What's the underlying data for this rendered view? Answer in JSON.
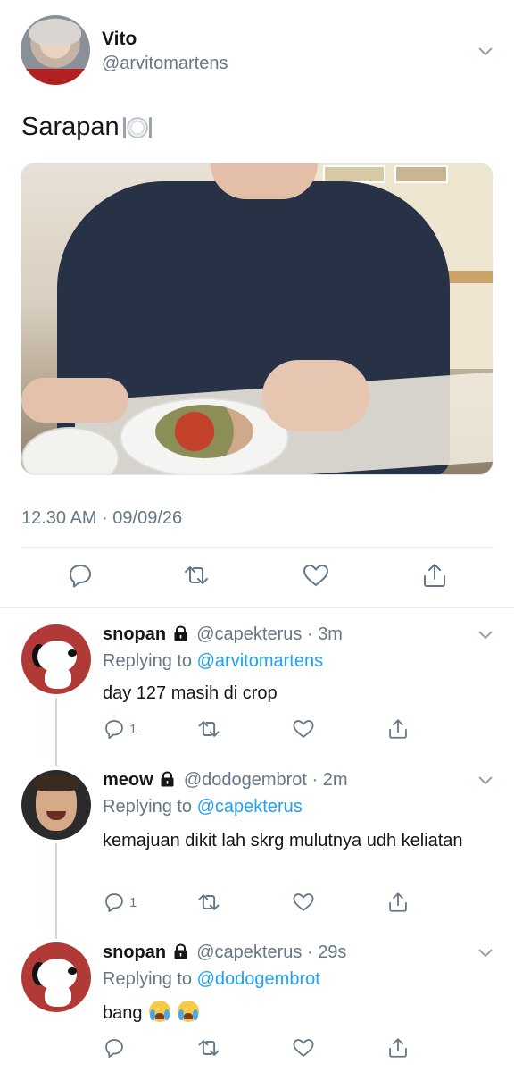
{
  "main_tweet": {
    "author_name": "Vito",
    "author_handle": "@arvitomartens",
    "text": "Sarapan",
    "text_emoji": "fork-knife-plate-emoji",
    "timestamp": "12.30 AM · 09/09/26"
  },
  "replies": [
    {
      "name": "snopan",
      "handle": "@capekterus",
      "dot": "·",
      "time": "3m",
      "replying_label": "Replying to",
      "replying_to": "@arvitomartens",
      "text": "day 127 masih di crop",
      "reply_count": "1",
      "avatar": "snoopy-avatar"
    },
    {
      "name": "meow",
      "handle": "@dodogembrot",
      "dot": "·",
      "time": "2m",
      "replying_label": "Replying to",
      "replying_to": "@capekterus",
      "text": "kemajuan dikit lah skrg mulutnya udh keliatan",
      "reply_count": "1",
      "avatar": "face-avatar"
    },
    {
      "name": "snopan",
      "handle": "@capekterus",
      "dot": "·",
      "time": "29s",
      "replying_label": "Replying to",
      "replying_to": "@dodogembrot",
      "text": "bang",
      "reply_count": "",
      "avatar": "snoopy-avatar"
    }
  ],
  "colors": {
    "accent": "#1da1f2",
    "muted": "#657786",
    "text": "#14171a",
    "divider": "#e6ecf0"
  }
}
